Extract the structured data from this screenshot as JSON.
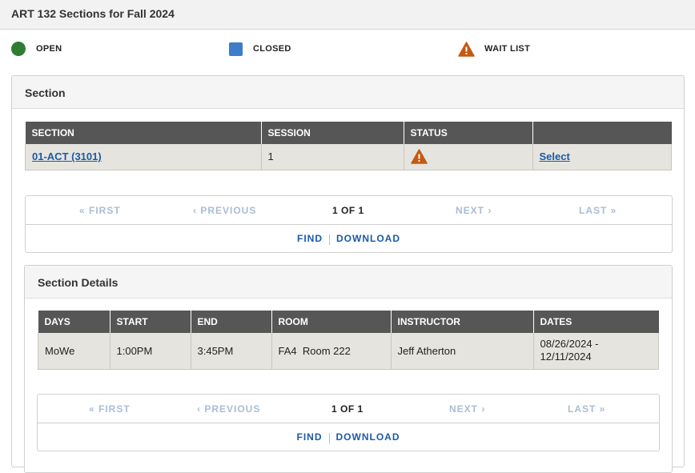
{
  "page": {
    "title": "ART 132 Sections for Fall 2024"
  },
  "legend": {
    "open": "OPEN",
    "closed": "CLOSED",
    "waitlist": "WAIT LIST"
  },
  "colors": {
    "open": "#2e7d32",
    "closed": "#3d7cc9",
    "waitlist": "#c55a11",
    "header_bg": "#565656",
    "row_bg": "#e6e4de",
    "link": "#1a5aa8"
  },
  "section_panel": {
    "title": "Section",
    "columns": [
      "SECTION",
      "SESSION",
      "STATUS",
      ""
    ],
    "rows": [
      {
        "section": "01-ACT (3101)",
        "session": "1",
        "status_icon": "waitlist-warning-icon",
        "action": "Select"
      }
    ],
    "pager": {
      "first": "« FIRST",
      "previous": "‹ PREVIOUS",
      "current": "1 OF 1",
      "next": "NEXT ›",
      "last": "LAST »",
      "find": "FIND",
      "download": "DOWNLOAD"
    }
  },
  "details_panel": {
    "title": "Section Details",
    "columns": [
      "DAYS",
      "START",
      "END",
      "ROOM",
      "INSTRUCTOR",
      "DATES"
    ],
    "rows": [
      {
        "days": "MoWe",
        "start": "1:00PM",
        "end": "3:45PM",
        "room": "FA4  Room 222",
        "instructor": "Jeff Atherton",
        "dates": "08/26/2024 - 12/11/2024"
      }
    ],
    "pager": {
      "first": "« FIRST",
      "previous": "‹ PREVIOUS",
      "current": "1 OF 1",
      "next": "NEXT ›",
      "last": "LAST »",
      "find": "FIND",
      "download": "DOWNLOAD"
    }
  }
}
